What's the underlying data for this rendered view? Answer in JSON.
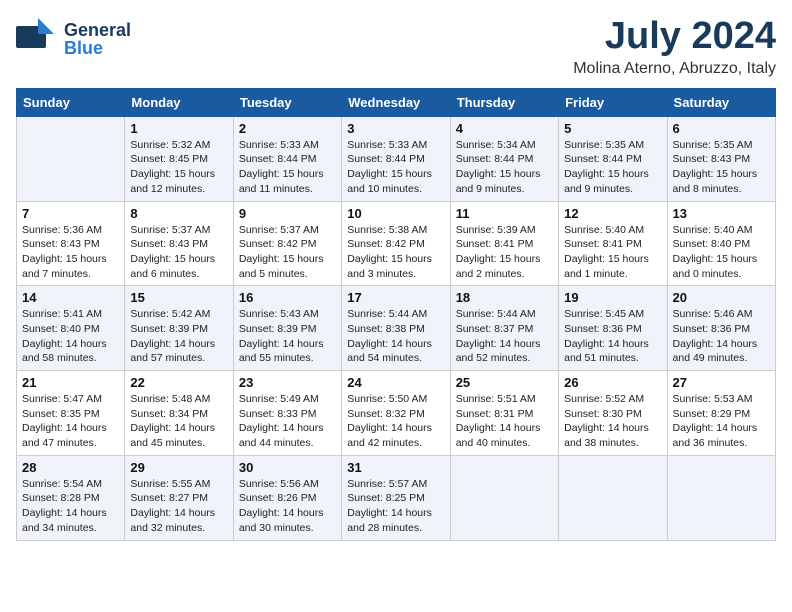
{
  "header": {
    "logo_general": "General",
    "logo_blue": "Blue",
    "month": "July 2024",
    "location": "Molina Aterno, Abruzzo, Italy"
  },
  "days_of_week": [
    "Sunday",
    "Monday",
    "Tuesday",
    "Wednesday",
    "Thursday",
    "Friday",
    "Saturday"
  ],
  "weeks": [
    [
      {
        "day": "",
        "info": ""
      },
      {
        "day": "1",
        "info": "Sunrise: 5:32 AM\nSunset: 8:45 PM\nDaylight: 15 hours\nand 12 minutes."
      },
      {
        "day": "2",
        "info": "Sunrise: 5:33 AM\nSunset: 8:44 PM\nDaylight: 15 hours\nand 11 minutes."
      },
      {
        "day": "3",
        "info": "Sunrise: 5:33 AM\nSunset: 8:44 PM\nDaylight: 15 hours\nand 10 minutes."
      },
      {
        "day": "4",
        "info": "Sunrise: 5:34 AM\nSunset: 8:44 PM\nDaylight: 15 hours\nand 9 minutes."
      },
      {
        "day": "5",
        "info": "Sunrise: 5:35 AM\nSunset: 8:44 PM\nDaylight: 15 hours\nand 9 minutes."
      },
      {
        "day": "6",
        "info": "Sunrise: 5:35 AM\nSunset: 8:43 PM\nDaylight: 15 hours\nand 8 minutes."
      }
    ],
    [
      {
        "day": "7",
        "info": "Sunrise: 5:36 AM\nSunset: 8:43 PM\nDaylight: 15 hours\nand 7 minutes."
      },
      {
        "day": "8",
        "info": "Sunrise: 5:37 AM\nSunset: 8:43 PM\nDaylight: 15 hours\nand 6 minutes."
      },
      {
        "day": "9",
        "info": "Sunrise: 5:37 AM\nSunset: 8:42 PM\nDaylight: 15 hours\nand 5 minutes."
      },
      {
        "day": "10",
        "info": "Sunrise: 5:38 AM\nSunset: 8:42 PM\nDaylight: 15 hours\nand 3 minutes."
      },
      {
        "day": "11",
        "info": "Sunrise: 5:39 AM\nSunset: 8:41 PM\nDaylight: 15 hours\nand 2 minutes."
      },
      {
        "day": "12",
        "info": "Sunrise: 5:40 AM\nSunset: 8:41 PM\nDaylight: 15 hours\nand 1 minute."
      },
      {
        "day": "13",
        "info": "Sunrise: 5:40 AM\nSunset: 8:40 PM\nDaylight: 15 hours\nand 0 minutes."
      }
    ],
    [
      {
        "day": "14",
        "info": "Sunrise: 5:41 AM\nSunset: 8:40 PM\nDaylight: 14 hours\nand 58 minutes."
      },
      {
        "day": "15",
        "info": "Sunrise: 5:42 AM\nSunset: 8:39 PM\nDaylight: 14 hours\nand 57 minutes."
      },
      {
        "day": "16",
        "info": "Sunrise: 5:43 AM\nSunset: 8:39 PM\nDaylight: 14 hours\nand 55 minutes."
      },
      {
        "day": "17",
        "info": "Sunrise: 5:44 AM\nSunset: 8:38 PM\nDaylight: 14 hours\nand 54 minutes."
      },
      {
        "day": "18",
        "info": "Sunrise: 5:44 AM\nSunset: 8:37 PM\nDaylight: 14 hours\nand 52 minutes."
      },
      {
        "day": "19",
        "info": "Sunrise: 5:45 AM\nSunset: 8:36 PM\nDaylight: 14 hours\nand 51 minutes."
      },
      {
        "day": "20",
        "info": "Sunrise: 5:46 AM\nSunset: 8:36 PM\nDaylight: 14 hours\nand 49 minutes."
      }
    ],
    [
      {
        "day": "21",
        "info": "Sunrise: 5:47 AM\nSunset: 8:35 PM\nDaylight: 14 hours\nand 47 minutes."
      },
      {
        "day": "22",
        "info": "Sunrise: 5:48 AM\nSunset: 8:34 PM\nDaylight: 14 hours\nand 45 minutes."
      },
      {
        "day": "23",
        "info": "Sunrise: 5:49 AM\nSunset: 8:33 PM\nDaylight: 14 hours\nand 44 minutes."
      },
      {
        "day": "24",
        "info": "Sunrise: 5:50 AM\nSunset: 8:32 PM\nDaylight: 14 hours\nand 42 minutes."
      },
      {
        "day": "25",
        "info": "Sunrise: 5:51 AM\nSunset: 8:31 PM\nDaylight: 14 hours\nand 40 minutes."
      },
      {
        "day": "26",
        "info": "Sunrise: 5:52 AM\nSunset: 8:30 PM\nDaylight: 14 hours\nand 38 minutes."
      },
      {
        "day": "27",
        "info": "Sunrise: 5:53 AM\nSunset: 8:29 PM\nDaylight: 14 hours\nand 36 minutes."
      }
    ],
    [
      {
        "day": "28",
        "info": "Sunrise: 5:54 AM\nSunset: 8:28 PM\nDaylight: 14 hours\nand 34 minutes."
      },
      {
        "day": "29",
        "info": "Sunrise: 5:55 AM\nSunset: 8:27 PM\nDaylight: 14 hours\nand 32 minutes."
      },
      {
        "day": "30",
        "info": "Sunrise: 5:56 AM\nSunset: 8:26 PM\nDaylight: 14 hours\nand 30 minutes."
      },
      {
        "day": "31",
        "info": "Sunrise: 5:57 AM\nSunset: 8:25 PM\nDaylight: 14 hours\nand 28 minutes."
      },
      {
        "day": "",
        "info": ""
      },
      {
        "day": "",
        "info": ""
      },
      {
        "day": "",
        "info": ""
      }
    ]
  ]
}
